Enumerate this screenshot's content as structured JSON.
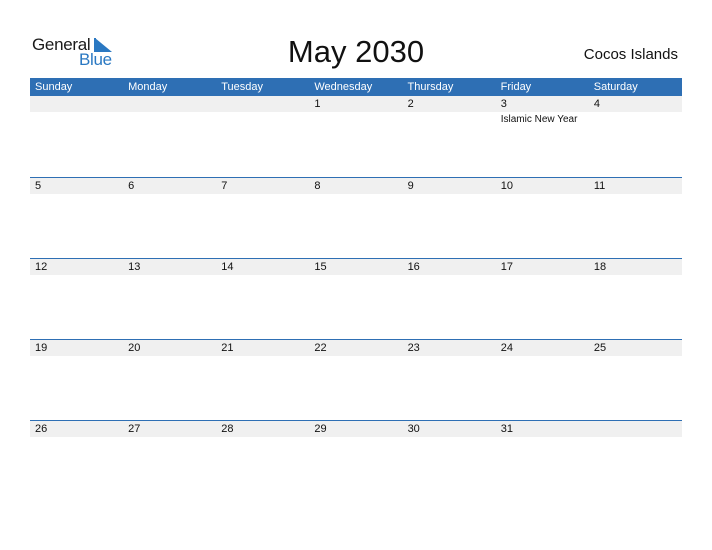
{
  "logo": {
    "line1": "General",
    "line2": "Blue",
    "icon": "blue-triangle-flag-icon",
    "brand_color": "#2a78c2"
  },
  "title": "May 2030",
  "country": "Cocos Islands",
  "colors": {
    "header_bg": "#2e6fb4",
    "date_strip_bg": "#f0f0f0"
  },
  "weekdays": [
    "Sunday",
    "Monday",
    "Tuesday",
    "Wednesday",
    "Thursday",
    "Friday",
    "Saturday"
  ],
  "weeks": [
    {
      "days": [
        {
          "num": "",
          "event": ""
        },
        {
          "num": "",
          "event": ""
        },
        {
          "num": "",
          "event": ""
        },
        {
          "num": "1",
          "event": ""
        },
        {
          "num": "2",
          "event": ""
        },
        {
          "num": "3",
          "event": "Islamic New Year"
        },
        {
          "num": "4",
          "event": ""
        }
      ]
    },
    {
      "days": [
        {
          "num": "5",
          "event": ""
        },
        {
          "num": "6",
          "event": ""
        },
        {
          "num": "7",
          "event": ""
        },
        {
          "num": "8",
          "event": ""
        },
        {
          "num": "9",
          "event": ""
        },
        {
          "num": "10",
          "event": ""
        },
        {
          "num": "11",
          "event": ""
        }
      ]
    },
    {
      "days": [
        {
          "num": "12",
          "event": ""
        },
        {
          "num": "13",
          "event": ""
        },
        {
          "num": "14",
          "event": ""
        },
        {
          "num": "15",
          "event": ""
        },
        {
          "num": "16",
          "event": ""
        },
        {
          "num": "17",
          "event": ""
        },
        {
          "num": "18",
          "event": ""
        }
      ]
    },
    {
      "days": [
        {
          "num": "19",
          "event": ""
        },
        {
          "num": "20",
          "event": ""
        },
        {
          "num": "21",
          "event": ""
        },
        {
          "num": "22",
          "event": ""
        },
        {
          "num": "23",
          "event": ""
        },
        {
          "num": "24",
          "event": ""
        },
        {
          "num": "25",
          "event": ""
        }
      ]
    },
    {
      "days": [
        {
          "num": "26",
          "event": ""
        },
        {
          "num": "27",
          "event": ""
        },
        {
          "num": "28",
          "event": ""
        },
        {
          "num": "29",
          "event": ""
        },
        {
          "num": "30",
          "event": ""
        },
        {
          "num": "31",
          "event": ""
        },
        {
          "num": "",
          "event": ""
        }
      ]
    }
  ]
}
